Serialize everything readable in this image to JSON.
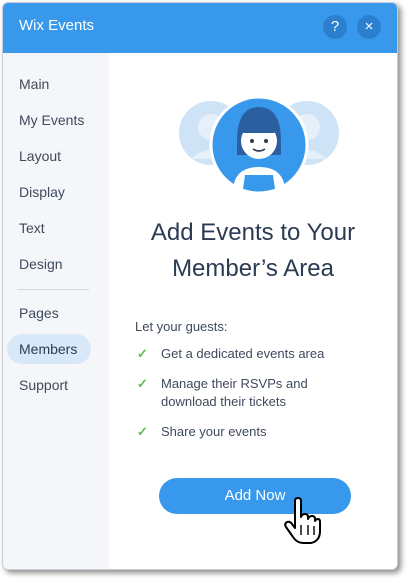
{
  "header": {
    "title": "Wix Events",
    "help_icon": "?",
    "close_icon": "×"
  },
  "sidebar": {
    "items": [
      {
        "label": "Main"
      },
      {
        "label": "My Events"
      },
      {
        "label": "Layout"
      },
      {
        "label": "Display"
      },
      {
        "label": "Text"
      },
      {
        "label": "Design"
      },
      {
        "label": "Pages"
      },
      {
        "label": "Members",
        "active": true
      },
      {
        "label": "Support"
      }
    ]
  },
  "main": {
    "title_line1": "Add Events to Your",
    "title_line2": "Member’s Area",
    "intro": "Let your guests:",
    "check_glyph": "✓",
    "benefits": [
      {
        "line1": "Get a dedicated events area"
      },
      {
        "line1": "Manage their RSVPs and",
        "line2": "download their tickets"
      },
      {
        "line1": "Share your events"
      }
    ],
    "cta_label": "Add Now"
  },
  "colors": {
    "accent": "#3899ec",
    "header_button": "#2b7fcf",
    "sidebar_bg": "#f4f6f9",
    "active_item_bg": "#d9e8f8",
    "text_dark": "#2b3b53",
    "check_green": "#60bc57"
  },
  "icons": [
    "help-icon",
    "close-icon",
    "members-illustration",
    "check-icon",
    "hand-pointer-cursor-icon"
  ]
}
